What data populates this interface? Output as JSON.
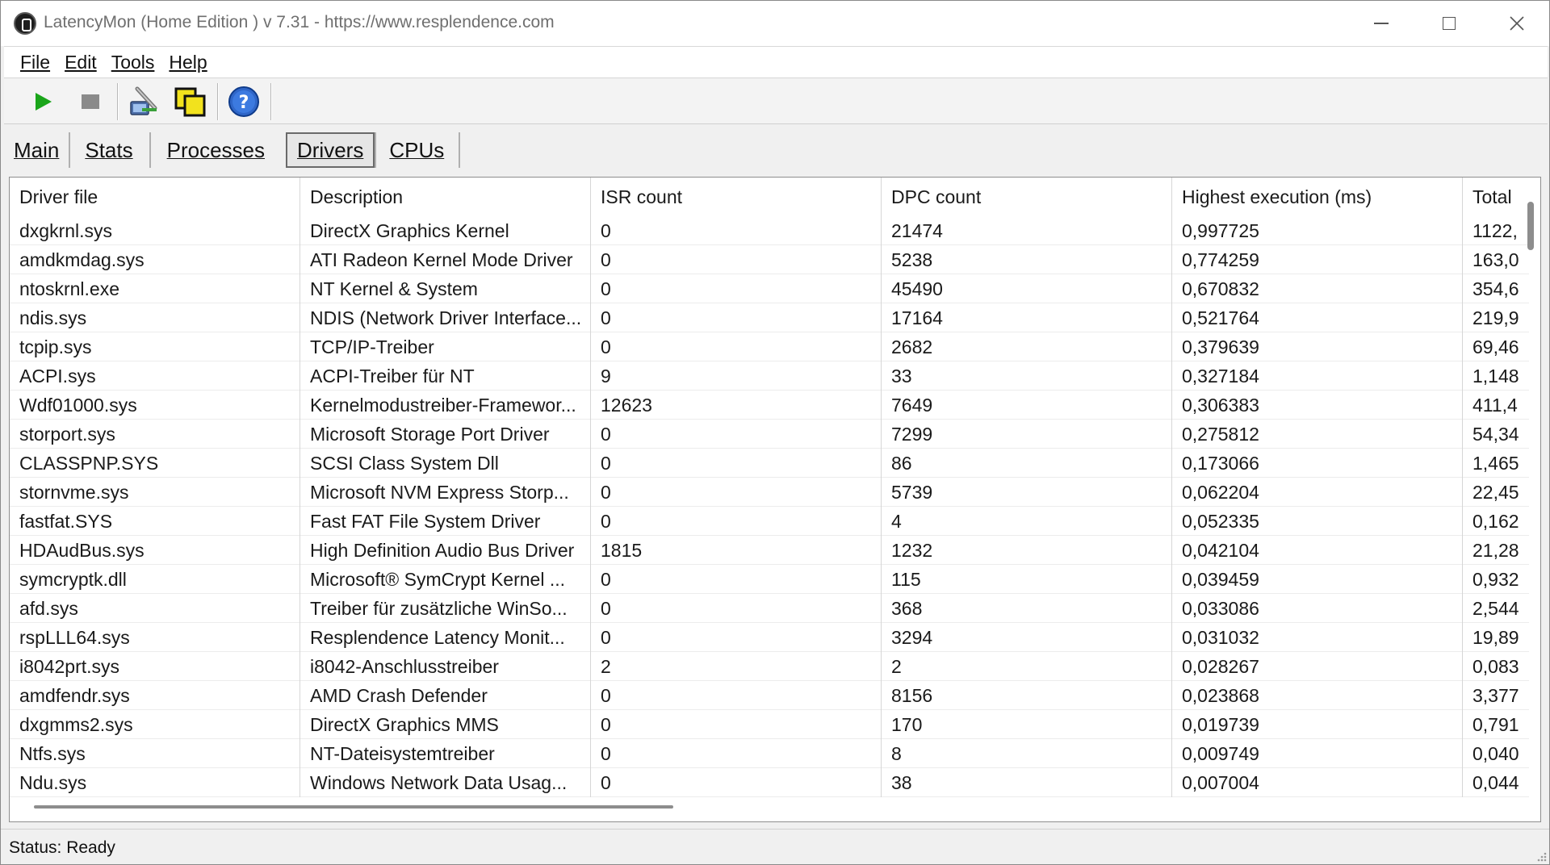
{
  "window": {
    "title": "LatencyMon  (Home Edition )  v 7.31 - https://www.resplendence.com"
  },
  "menu": [
    {
      "label": "File"
    },
    {
      "label": "Edit"
    },
    {
      "label": "Tools"
    },
    {
      "label": "Help"
    }
  ],
  "toolbar": {
    "icons": [
      "play-icon",
      "stop-icon",
      "properties-icon",
      "copy-icon",
      "help-icon"
    ]
  },
  "tabs": [
    {
      "label": "Main"
    },
    {
      "label": "Stats"
    },
    {
      "label": "Processes"
    },
    {
      "label": "Drivers",
      "active": true
    },
    {
      "label": "CPUs"
    }
  ],
  "table": {
    "headers": [
      "Driver file",
      "Description",
      "ISR count",
      "DPC count",
      "Highest execution (ms)",
      "Total"
    ],
    "rows": [
      [
        "dxgkrnl.sys",
        "DirectX Graphics Kernel",
        "0",
        "21474",
        "0,997725",
        "1122,"
      ],
      [
        "amdkmdag.sys",
        "ATI Radeon Kernel Mode Driver",
        "0",
        "5238",
        "0,774259",
        "163,0"
      ],
      [
        "ntoskrnl.exe",
        "NT Kernel & System",
        "0",
        "45490",
        "0,670832",
        "354,6"
      ],
      [
        "ndis.sys",
        "NDIS (Network Driver Interface...",
        "0",
        "17164",
        "0,521764",
        "219,9"
      ],
      [
        "tcpip.sys",
        "TCP/IP-Treiber",
        "0",
        "2682",
        "0,379639",
        "69,46"
      ],
      [
        "ACPI.sys",
        "ACPI-Treiber für NT",
        "9",
        "33",
        "0,327184",
        "1,148"
      ],
      [
        "Wdf01000.sys",
        "Kernelmodustreiber-Framewor...",
        "12623",
        "7649",
        "0,306383",
        "411,4"
      ],
      [
        "storport.sys",
        "Microsoft Storage Port Driver",
        "0",
        "7299",
        "0,275812",
        "54,34"
      ],
      [
        "CLASSPNP.SYS",
        "SCSI Class System Dll",
        "0",
        "86",
        "0,173066",
        "1,465"
      ],
      [
        "stornvme.sys",
        "Microsoft NVM Express Storp...",
        "0",
        "5739",
        "0,062204",
        "22,45"
      ],
      [
        "fastfat.SYS",
        "Fast FAT File System Driver",
        "0",
        "4",
        "0,052335",
        "0,162"
      ],
      [
        "HDAudBus.sys",
        "High Definition Audio Bus Driver",
        "1815",
        "1232",
        "0,042104",
        "21,28"
      ],
      [
        "symcryptk.dll",
        "Microsoft® SymCrypt Kernel ...",
        "0",
        "115",
        "0,039459",
        "0,932"
      ],
      [
        "afd.sys",
        "Treiber für zusätzliche WinSo...",
        "0",
        "368",
        "0,033086",
        "2,544"
      ],
      [
        "rspLLL64.sys",
        "Resplendence Latency Monit...",
        "0",
        "3294",
        "0,031032",
        "19,89"
      ],
      [
        "i8042prt.sys",
        "i8042-Anschlusstreiber",
        "2",
        "2",
        "0,028267",
        "0,083"
      ],
      [
        "amdfendr.sys",
        "AMD Crash Defender",
        "0",
        "8156",
        "0,023868",
        "3,377"
      ],
      [
        "dxgmms2.sys",
        "DirectX Graphics MMS",
        "0",
        "170",
        "0,019739",
        "0,791"
      ],
      [
        "Ntfs.sys",
        "NT-Dateisystemtreiber",
        "0",
        "8",
        "0,009749",
        "0,040"
      ],
      [
        "Ndu.sys",
        "Windows Network Data Usag...",
        "0",
        "38",
        "0,007004",
        "0,044"
      ]
    ]
  },
  "status": {
    "text": "Status: Ready"
  }
}
